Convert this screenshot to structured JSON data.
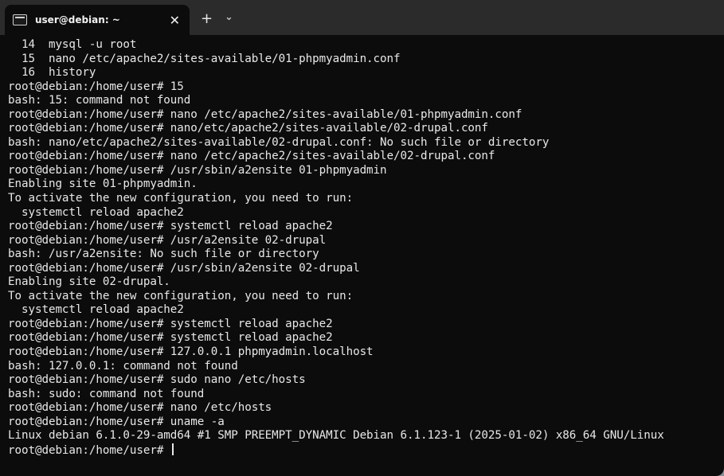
{
  "tab": {
    "title": "user@debian: ~",
    "close_label": "✕",
    "new_tab_label": "+",
    "dropdown_label": "⌄"
  },
  "terminal": {
    "lines": [
      "  14  mysql -u root",
      "  15  nano /etc/apache2/sites-available/01-phpmyadmin.conf",
      "  16  history",
      "root@debian:/home/user# 15",
      "bash: 15: command not found",
      "root@debian:/home/user# nano /etc/apache2/sites-available/01-phpmyadmin.conf",
      "root@debian:/home/user# nano/etc/apache2/sites-available/02-drupal.conf",
      "bash: nano/etc/apache2/sites-available/02-drupal.conf: No such file or directory",
      "root@debian:/home/user# nano /etc/apache2/sites-available/02-drupal.conf",
      "root@debian:/home/user# /usr/sbin/a2ensite 01-phpmyadmin",
      "Enabling site 01-phpmyadmin.",
      "To activate the new configuration, you need to run:",
      "  systemctl reload apache2",
      "root@debian:/home/user# systemctl reload apache2",
      "root@debian:/home/user# /usr/a2ensite 02-drupal",
      "bash: /usr/a2ensite: No such file or directory",
      "root@debian:/home/user# /usr/sbin/a2ensite 02-drupal",
      "Enabling site 02-drupal.",
      "To activate the new configuration, you need to run:",
      "  systemctl reload apache2",
      "root@debian:/home/user# systemctl reload apache2",
      "root@debian:/home/user# systemctl reload apache2",
      "root@debian:/home/user# 127.0.0.1 phpmyadmin.localhost",
      "bash: 127.0.0.1: command not found",
      "root@debian:/home/user# sudo nano /etc/hosts",
      "bash: sudo: command not found",
      "root@debian:/home/user# nano /etc/hosts",
      "root@debian:/home/user# uname -a",
      "Linux debian 6.1.0-29-amd64 #1 SMP PREEMPT_DYNAMIC Debian 6.1.123-1 (2025-01-02) x86_64 GNU/Linux"
    ],
    "prompt": "root@debian:/home/user# "
  },
  "colors": {
    "background": "#0c0c0c",
    "titlebar": "#2b2b2b",
    "text": "#e8e8e8"
  }
}
